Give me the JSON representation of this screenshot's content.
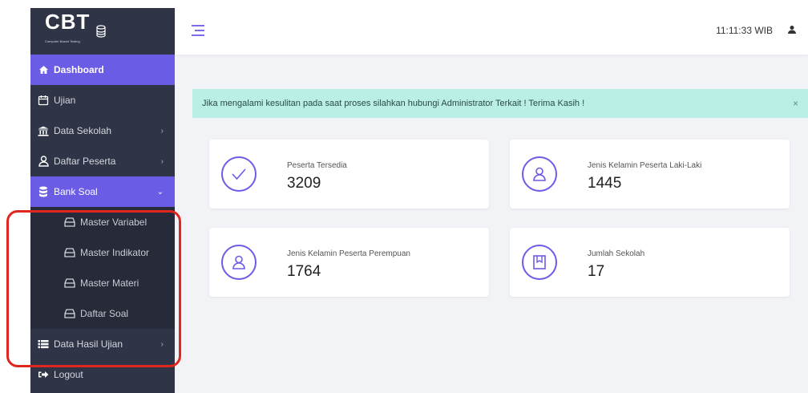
{
  "brand": {
    "logo_text": "CBT",
    "logo_subtitle": "Computer Based Testing"
  },
  "sidebar": {
    "items": [
      {
        "label": "Dashboard"
      },
      {
        "label": "Ujian"
      },
      {
        "label": "Data Sekolah"
      },
      {
        "label": "Daftar Peserta"
      },
      {
        "label": "Bank Soal"
      }
    ],
    "sub_items": [
      {
        "label": "Master Variabel"
      },
      {
        "label": "Master Indikator"
      },
      {
        "label": "Master Materi"
      },
      {
        "label": "Daftar Soal"
      }
    ],
    "bottom_items": [
      {
        "label": "Data Hasil Ujian"
      },
      {
        "label": "Logout"
      }
    ]
  },
  "topbar": {
    "time": "11:11:33 WIB"
  },
  "alert": {
    "message": "Jika mengalami kesulitan pada saat proses silahkan hubungi Administrator Terkait ! Terima Kasih !",
    "close": "×"
  },
  "stats": [
    {
      "label": "Peserta Tersedia",
      "value": "3209",
      "icon": "check-icon"
    },
    {
      "label": "Jenis Kelamin Peserta Laki-Laki",
      "value": "1445",
      "icon": "user-icon"
    },
    {
      "label": "Jenis Kelamin Peserta Perempuan",
      "value": "1764",
      "icon": "user-icon"
    },
    {
      "label": "Jumlah Sekolah",
      "value": "17",
      "icon": "book-icon"
    }
  ],
  "colors": {
    "sidebar": "#2f3446",
    "accent": "#6b5ce6",
    "alert_bg": "#b9efe5",
    "annotation": "#e0271f"
  }
}
